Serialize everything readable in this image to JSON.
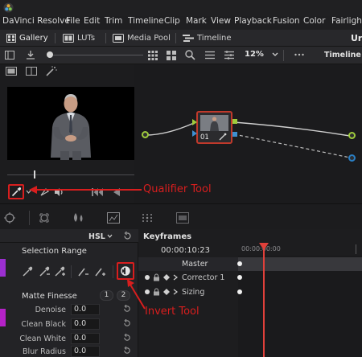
{
  "menubar": {
    "items": [
      "DaVinci Resolve",
      "File",
      "Edit",
      "Trim",
      "Timeline",
      "Clip",
      "Mark",
      "View",
      "Playback",
      "Fusion",
      "Color",
      "Fairlight"
    ]
  },
  "pagebar": {
    "tabs": [
      "Gallery",
      "LUTs",
      "Media Pool",
      "Timeline"
    ],
    "project_title_partial": "Ur"
  },
  "toolbar": {
    "zoom": "12%",
    "panel_label": "Timeline"
  },
  "node_graph": {
    "node_label": "01"
  },
  "qualifier_panel": {
    "mode": "HSL",
    "section_selection": "Selection Range",
    "section_matte": "Matte Finesse",
    "pages": [
      "1",
      "2"
    ],
    "params": [
      {
        "label": "Denoise",
        "value": "0.0"
      },
      {
        "label": "Clean Black",
        "value": "0.0"
      },
      {
        "label": "Clean White",
        "value": "0.0"
      },
      {
        "label": "Blur Radius",
        "value": "0.0"
      }
    ]
  },
  "keyframes": {
    "title": "Keyframes",
    "timecode": "00:00:10:23",
    "ruler_timecode": "00:00:00:00",
    "rows": [
      "Master",
      "Corrector 1",
      "Sizing"
    ]
  },
  "annotations": {
    "qualifier": "Qualifier Tool",
    "invert": "Invert Tool"
  },
  "colors": {
    "annotation_red": "#d81e1e",
    "playhead_red": "#e0403a",
    "accent_purple": "#9b2fd0"
  }
}
